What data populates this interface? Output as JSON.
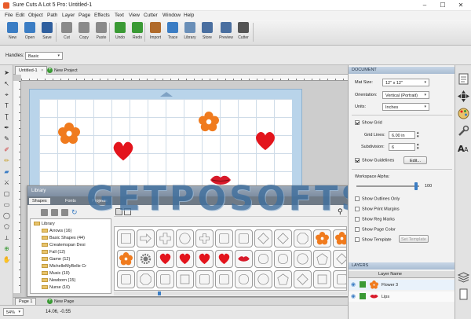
{
  "window": {
    "title": "Sure Cuts A Lot 5 Pro: Untitled-1",
    "minimize_glyph": "–",
    "maximize_glyph": "☐",
    "close_glyph": "✕"
  },
  "menu": [
    "File",
    "Edit",
    "Object",
    "Path",
    "Layer",
    "Page",
    "Effects",
    "Text",
    "View",
    "Cutter",
    "Window",
    "Help"
  ],
  "toolbar": [
    {
      "label": "New",
      "icon": "new-doc-icon",
      "color": "#3b7dc4"
    },
    {
      "label": "Open",
      "icon": "open-folder-icon",
      "color": "#3b7dc4"
    },
    {
      "label": "Save",
      "icon": "save-icon",
      "color": "#2f5f9e"
    },
    {
      "label": "Cut",
      "icon": "scissors-icon",
      "color": "#8a8a8a"
    },
    {
      "label": "Copy",
      "icon": "copy-icon",
      "color": "#8a8a8a"
    },
    {
      "label": "Paste",
      "icon": "paste-icon",
      "color": "#8a8a8a"
    },
    {
      "label": "Undo",
      "icon": "undo-icon",
      "color": "#3a9a34"
    },
    {
      "label": "Redo",
      "icon": "redo-icon",
      "color": "#3a9a34"
    },
    {
      "label": "Import",
      "icon": "import-icon",
      "color": "#b06a2a"
    },
    {
      "label": "Trace",
      "icon": "trace-icon",
      "color": "#3b7dc4"
    },
    {
      "label": "Library",
      "icon": "library-icon",
      "color": "#6a8fb8"
    },
    {
      "label": "Store",
      "icon": "store-icon",
      "color": "#4a6fa0"
    },
    {
      "label": "Preview",
      "icon": "preview-icon",
      "color": "#4a6fa0"
    },
    {
      "label": "Cutter",
      "icon": "cutter-icon",
      "color": "#555555"
    }
  ],
  "handles": {
    "label": "Handles:",
    "value": "Basic"
  },
  "doc_tabs": {
    "current": "Untitled-1",
    "close_glyph": "×",
    "new_project": "New Project"
  },
  "library": {
    "title": "Library",
    "tabs": [
      "Shapes",
      "Fonts",
      "Projects"
    ],
    "tree": [
      "Library",
      "Arrows (16)",
      "Basic Shapes (44)",
      "Createmspan Desi",
      "Fall (12)",
      "Game (12)",
      "MichelleMyBelle Cr",
      "Music (10)",
      "Newborn (15)",
      "Nurse (10)"
    ]
  },
  "watermark": "GETPOSOFTS",
  "bottom": {
    "page_tab": "Page 1",
    "new_page": "New Page",
    "zoom": "54%",
    "coords": "14.06, -0.55"
  },
  "document_panel": {
    "header": "DOCUMENT",
    "mat_size_label": "Mat Size:",
    "mat_size": "12\" x 12\"",
    "orientation_label": "Orientation:",
    "orientation": "Vertical (Portrait)",
    "units_label": "Units:",
    "units": "Inches",
    "show_grid": "Show Grid",
    "grid_lines_label": "Grid Lines:",
    "grid_lines": "6.00 in",
    "subdivision_label": "Subdivision:",
    "subdivision": "6",
    "show_guidelines": "Show Guidelines",
    "edit_button": "Edit...",
    "workspace_alpha_label": "Workspace Alpha:",
    "workspace_alpha": "100",
    "workspace_alpha_level": 0.95,
    "show_outlines_only": "Show Outlines Only",
    "show_print_margins": "Show Print Margins",
    "show_reg_marks": "Show Reg Marks",
    "show_page_color": "Show Page Color",
    "show_template": "Show Template",
    "set_template": "Set Template"
  },
  "layers_panel": {
    "header": "LAYERS",
    "col_name": "Layer Name",
    "items": [
      "Flower 3",
      "Lips"
    ]
  },
  "colors": {
    "flower": "#f07b1e",
    "heart": "#e3141c",
    "lips": "#d81a2a",
    "accent_green": "#3a9a34",
    "panel_header": "#a9bdd3"
  }
}
